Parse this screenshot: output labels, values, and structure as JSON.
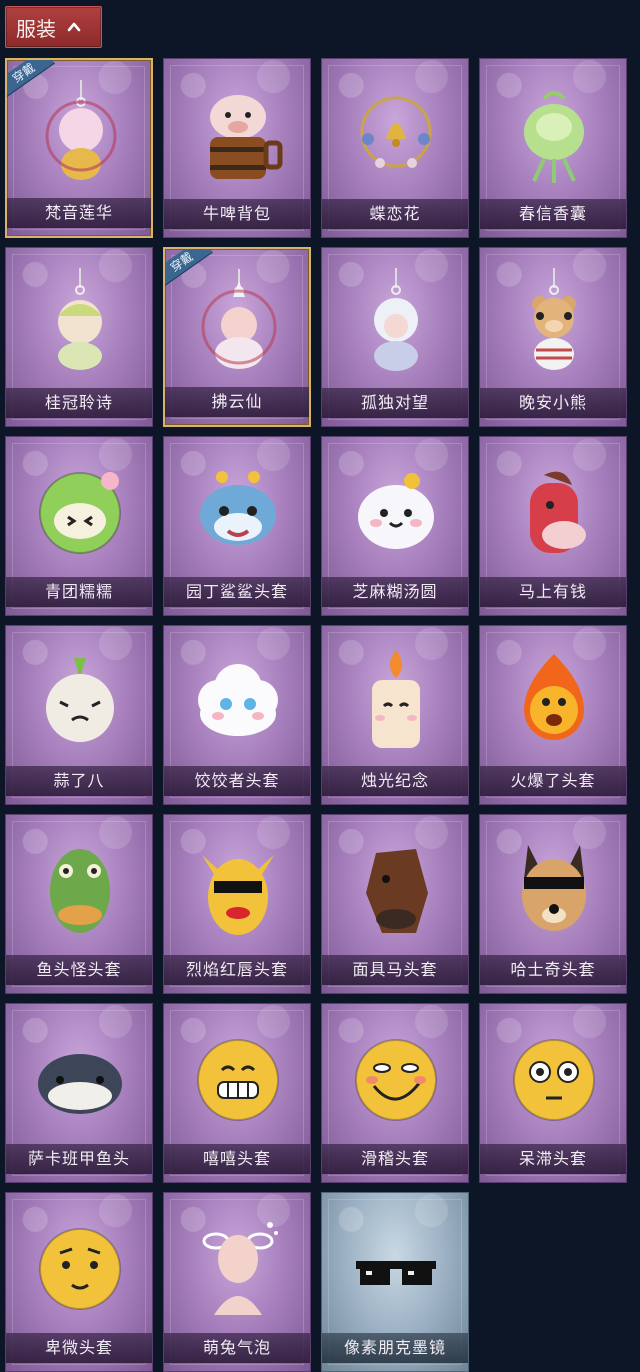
{
  "header": {
    "tab_label": "服装"
  },
  "colors": {
    "background": "#0d1626",
    "tab": "#a23838",
    "card_purple": "#a780bd",
    "card_blue": "#9fb4c6",
    "equipped_border": "#d9b36a",
    "badge": "#3a6690"
  },
  "badge_label": "穿戴",
  "items": [
    {
      "name": "梵音莲华",
      "equipped": true,
      "style": "purple",
      "art": "pendant-lotus-doll"
    },
    {
      "name": "牛啤背包",
      "equipped": false,
      "style": "purple",
      "art": "cow-barrel"
    },
    {
      "name": "蝶恋花",
      "equipped": false,
      "style": "purple",
      "art": "bell-wreath"
    },
    {
      "name": "春信香囊",
      "equipped": false,
      "style": "purple",
      "art": "green-sachet"
    },
    {
      "name": "桂冠聆诗",
      "equipped": false,
      "style": "purple",
      "art": "pendant-green-doll"
    },
    {
      "name": "拂云仙",
      "equipped": true,
      "style": "purple",
      "art": "pendant-cloud-doll"
    },
    {
      "name": "孤独对望",
      "equipped": false,
      "style": "purple",
      "art": "pendant-white-doll"
    },
    {
      "name": "晚安小熊",
      "equipped": false,
      "style": "purple",
      "art": "pendant-bear"
    },
    {
      "name": "青团糯糯",
      "equipped": false,
      "style": "purple",
      "art": "green-mochi"
    },
    {
      "name": "园丁鲨鲨头套",
      "equipped": false,
      "style": "purple",
      "art": "shark-head"
    },
    {
      "name": "芝麻糊汤圆",
      "equipped": false,
      "style": "purple",
      "art": "dumpling"
    },
    {
      "name": "马上有钱",
      "equipped": false,
      "style": "purple",
      "art": "red-horse"
    },
    {
      "name": "蒜了八",
      "equipped": false,
      "style": "purple",
      "art": "garlic"
    },
    {
      "name": "饺饺者头套",
      "equipped": false,
      "style": "purple",
      "art": "cloud-dumpling"
    },
    {
      "name": "烛光纪念",
      "equipped": false,
      "style": "purple",
      "art": "candle"
    },
    {
      "name": "火爆了头套",
      "equipped": false,
      "style": "purple",
      "art": "fireball"
    },
    {
      "name": "鱼头怪头套",
      "equipped": false,
      "style": "purple",
      "art": "fish-head"
    },
    {
      "name": "烈焰红唇头套",
      "equipped": false,
      "style": "purple",
      "art": "yellow-pika"
    },
    {
      "name": "面具马头套",
      "equipped": false,
      "style": "purple",
      "art": "horse-mask"
    },
    {
      "name": "哈士奇头套",
      "equipped": false,
      "style": "purple",
      "art": "husky"
    },
    {
      "name": "萨卡班甲鱼头",
      "equipped": false,
      "style": "purple",
      "art": "sacabambaspis"
    },
    {
      "name": "嘻嘻头套",
      "equipped": false,
      "style": "purple",
      "art": "grin-emoji"
    },
    {
      "name": "滑稽头套",
      "equipped": false,
      "style": "purple",
      "art": "smirk-emoji"
    },
    {
      "name": "呆滞头套",
      "equipped": false,
      "style": "purple",
      "art": "dazed-emoji"
    },
    {
      "name": "卑微头套",
      "equipped": false,
      "style": "purple",
      "art": "humble-emoji"
    },
    {
      "name": "萌兔气泡",
      "equipped": false,
      "style": "purple",
      "art": "bunny-bubble"
    },
    {
      "name": "像素朋克墨镜",
      "equipped": false,
      "style": "blue",
      "art": "pixel-sunglasses"
    }
  ]
}
